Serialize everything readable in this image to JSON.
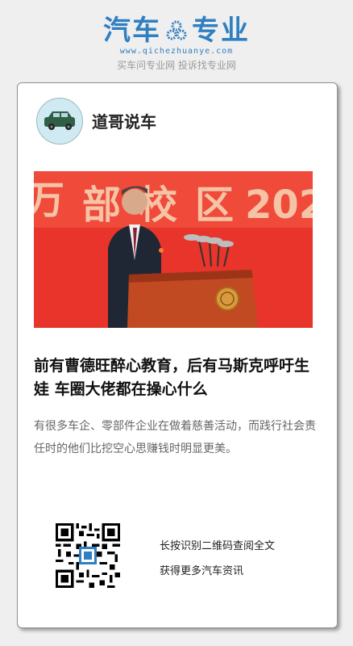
{
  "brand": {
    "name_left": "汽车",
    "name_right": "专业",
    "url": "www.qichezhuanye.com",
    "slogan": "买车问专业网 投诉找专业网",
    "color": "#2f7fc1"
  },
  "card": {
    "author": "道哥说车",
    "avatar_icon": "car-icon",
    "image_icon": "speaker-at-podium-photo",
    "title": "前有曹德旺醉心教育，后有马斯克呼吁生娃 车圈大佬都在操心什么",
    "summary": "有很多车企、零部件企业在做着慈善活动，而践行社会责任时的他们比挖空心思赚钱时明显更美。",
    "qr_line1": "长按识别二维码查阅全文",
    "qr_line2": "获得更多汽车资讯"
  }
}
